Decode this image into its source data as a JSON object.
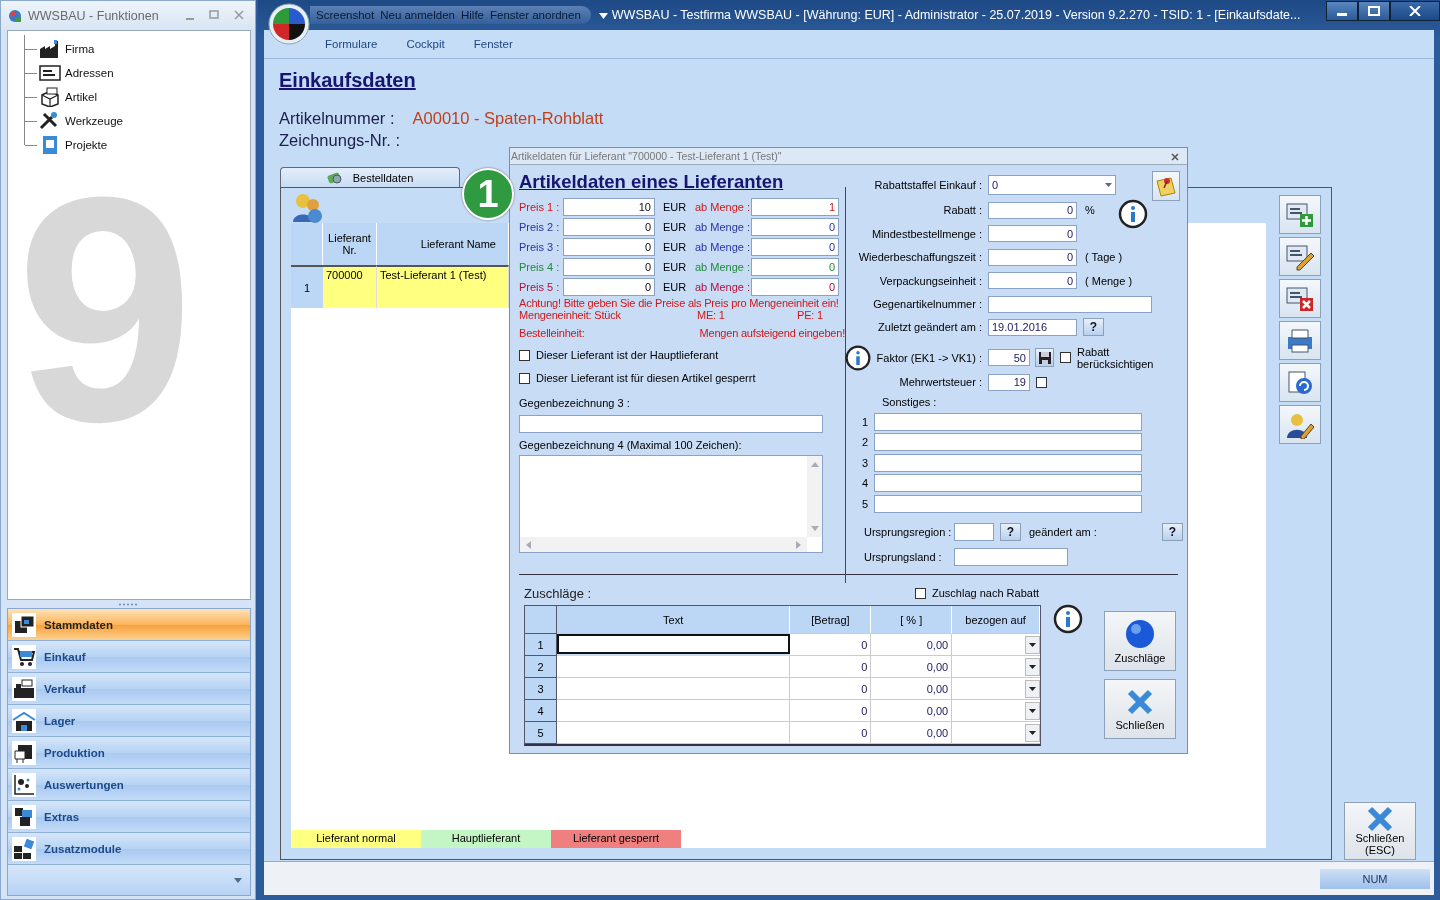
{
  "sidebar_window": {
    "title": "WWSBAU - Funktionen",
    "background_mark": "9",
    "tree": [
      {
        "label": "Firma"
      },
      {
        "label": "Adressen"
      },
      {
        "label": "Artikel"
      },
      {
        "label": "Werkzeuge"
      },
      {
        "label": "Projekte"
      }
    ],
    "nav": [
      {
        "label": "Stammdaten",
        "selected": true
      },
      {
        "label": "Einkauf",
        "selected": false
      },
      {
        "label": "Verkauf",
        "selected": false
      },
      {
        "label": "Lager",
        "selected": false
      },
      {
        "label": "Produktion",
        "selected": false
      },
      {
        "label": "Auswertungen",
        "selected": false
      },
      {
        "label": "Extras",
        "selected": false
      },
      {
        "label": "Zusatzmodule",
        "selected": false
      }
    ]
  },
  "main_window": {
    "quick_menu": [
      "Screenshot",
      "Neu anmelden",
      "Hilfe",
      "Fenster anordnen"
    ],
    "title": "WWSBAU - Testfirma WWSBAU - [Währung: EUR] - Administrator - 25.07.2019 - Version 9.2.270 - TSID: 1  - [Einkaufsdate...",
    "menu": [
      "Formulare",
      "Cockpit",
      "Fenster"
    ]
  },
  "page": {
    "heading": "Einkaufsdaten",
    "article_label": "Artikelnummer :",
    "article_value": "A00010 - Spaten-Rohblatt",
    "drawing_label": "Zeichnungs-Nr. :"
  },
  "supplier_panel": {
    "tab": "Bestelldaten",
    "columns": [
      "Lieferant Nr.",
      "Lieferant Name"
    ],
    "rows": [
      {
        "index": "1",
        "number": "700000",
        "name": "Test-Lieferant 1  (Test)",
        "color": "#ffff80"
      }
    ],
    "legend": [
      {
        "label": "Lieferant normal",
        "color": "#ffff80"
      },
      {
        "label": "Hauptlieferant",
        "color": "#c4f5c4"
      },
      {
        "label": "Lieferant gesperrt",
        "color": "#f08080"
      }
    ]
  },
  "close_button": {
    "lines": [
      "Schließen",
      "(ESC)"
    ]
  },
  "status_bar": {
    "num": "NUM"
  },
  "step_badge": "1",
  "dialog": {
    "title": "Artikeldaten für Lieferant \"700000 - Test-Lieferant 1  (Test)\"",
    "heading": "Artikeldaten eines Lieferanten",
    "prices": [
      {
        "label": "Preis 1 :",
        "value": "10",
        "currency": "EUR",
        "qty_label": "ab Menge :",
        "qty": "1",
        "color": "#d01818"
      },
      {
        "label": "Preis 2 :",
        "value": "0",
        "currency": "EUR",
        "qty_label": "ab Menge :",
        "qty": "0",
        "color": "#2a34a0"
      },
      {
        "label": "Preis 3 :",
        "value": "0",
        "currency": "EUR",
        "qty_label": "ab Menge :",
        "qty": "0",
        "color": "#2a34a0"
      },
      {
        "label": "Preis 4 :",
        "value": "0",
        "currency": "EUR",
        "qty_label": "ab Menge :",
        "qty": "0",
        "color": "#1f8a3c"
      },
      {
        "label": "Preis 5 :",
        "value": "0",
        "currency": "EUR",
        "qty_label": "ab Menge :",
        "qty": "0",
        "color": "#b0123c"
      }
    ],
    "warning": "Achtung! Bitte geben Sie die Preise als Preis pro Mengeneinheit ein!",
    "unit": "Mengeneinheit:  Stück",
    "me": "ME: 1",
    "pe": "PE: 1",
    "order_unit": "Bestelleinheit:",
    "ascending_note": "Mengen aufsteigend eingeben!",
    "checkboxes": [
      {
        "label": "Dieser Lieferant ist der Hauptlieferant",
        "checked": false
      },
      {
        "label": "Dieser Lieferant ist für diesen Artikel gesperrt",
        "checked": false
      }
    ],
    "counter_name_3": "Gegenbezeichnung 3 :",
    "counter_name_4": "Gegenbezeichnung 4 (Maximal 100 Zeichen):",
    "fields": [
      {
        "kind": "select",
        "label": "Rabattstaffel Einkauf :",
        "value": "0"
      },
      {
        "kind": "number",
        "label": "Rabatt :",
        "value": "0",
        "unit": "%"
      },
      {
        "kind": "number",
        "label": "Mindestbestellmenge :",
        "value": "0"
      },
      {
        "kind": "number",
        "label": "Wiederbeschaffungszeit :",
        "value": "0",
        "unit": "( Tage )"
      },
      {
        "kind": "number",
        "label": "Verpackungseinheit :",
        "value": "0",
        "unit": "( Menge )"
      },
      {
        "kind": "text",
        "label": "Gegenartikelnummer :"
      },
      {
        "kind": "date",
        "label": "Zuletzt geändert am :",
        "value": "19.01.2016",
        "help": "?"
      }
    ],
    "factor": {
      "label": "Faktor (EK1 -> VK1) :",
      "value": "50",
      "checkbox_label": "Rabatt berücksichtigen",
      "checked": false
    },
    "vat": {
      "label": "Mehrwertsteuer :",
      "value": "19",
      "checked": false
    },
    "misc": {
      "label": "Sonstiges :",
      "rows": [
        "1",
        "2",
        "3",
        "4",
        "5"
      ]
    },
    "origin": {
      "region_label": "Ursprungsregion :",
      "region_help": "?",
      "changed_label": "geändert am :",
      "changed_help": "?",
      "country_label": "Ursprungsland :"
    },
    "surcharges": {
      "label": "Zuschläge :",
      "after_discount": {
        "label": "Zuschlag nach Rabatt",
        "checked": false
      },
      "columns": [
        "Text",
        "[Betrag]",
        "[ % ]",
        "bezogen auf"
      ],
      "rows": [
        {
          "index": "1",
          "amount": "0",
          "percent": "0,00",
          "selected": true
        },
        {
          "index": "2",
          "amount": "0",
          "percent": "0,00",
          "selected": false
        },
        {
          "index": "3",
          "amount": "0",
          "percent": "0,00",
          "selected": false
        },
        {
          "index": "4",
          "amount": "0",
          "percent": "0,00",
          "selected": false
        },
        {
          "index": "5",
          "amount": "0",
          "percent": "0,00",
          "selected": false
        }
      ]
    },
    "buttons": [
      "Zuschläge",
      "Schließen"
    ]
  }
}
